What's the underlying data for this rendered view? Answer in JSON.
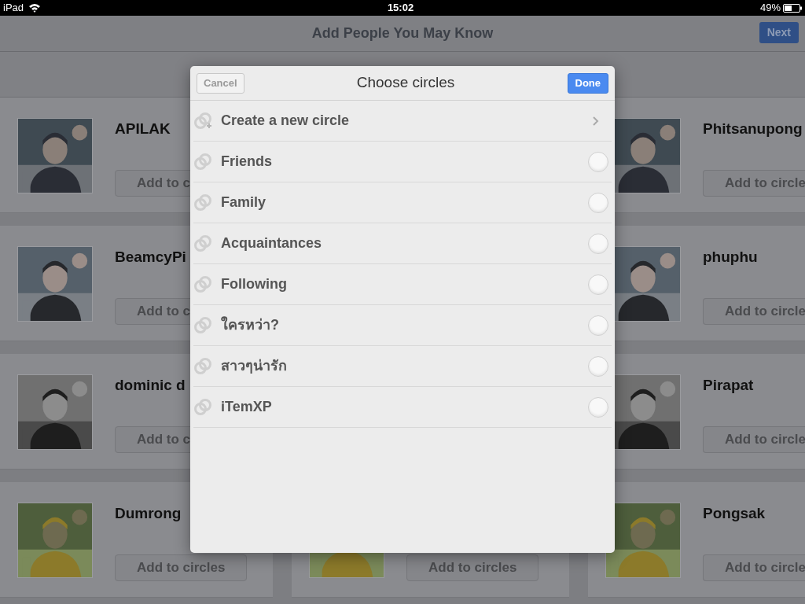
{
  "status_bar": {
    "device": "iPad",
    "time": "15:02",
    "battery": "49%"
  },
  "nav_bar": {
    "title": "Add People You May Know",
    "next_button": "Next"
  },
  "columns": [
    {
      "cards": [
        {
          "name": "APILAK",
          "button": "Add to c"
        },
        {
          "name": "BeamcyPi",
          "button": "Add to c"
        },
        {
          "name": "dominic d",
          "button": "Add to c"
        },
        {
          "name": "Dumrong",
          "button": "Add to circles"
        }
      ]
    },
    {
      "cards": [
        {
          "button": "Add to circles"
        }
      ]
    },
    {
      "cards": [
        {
          "name": "Phitsanupong",
          "button": "Add to circle"
        },
        {
          "name": "phuphu",
          "button": "Add to circle"
        },
        {
          "name": "Pirapat",
          "button": "Add to circle"
        },
        {
          "name": "Pongsak",
          "button": "Add to circle"
        }
      ]
    }
  ],
  "dialog": {
    "title": "Choose circles",
    "cancel_button": "Cancel",
    "done_button": "Done",
    "items": [
      {
        "kind": "create",
        "label": "Create a new circle"
      },
      {
        "kind": "circle",
        "label": "Friends",
        "selected": false
      },
      {
        "kind": "circle",
        "label": "Family",
        "selected": false
      },
      {
        "kind": "circle",
        "label": "Acquaintances",
        "selected": false
      },
      {
        "kind": "circle",
        "label": "Following",
        "selected": false
      },
      {
        "kind": "circle",
        "label": "ใครหว่า?",
        "selected": false
      },
      {
        "kind": "circle",
        "label": "สาวๆน่ารัก",
        "selected": false
      },
      {
        "kind": "circle",
        "label": "iTemXP",
        "selected": false
      }
    ]
  }
}
